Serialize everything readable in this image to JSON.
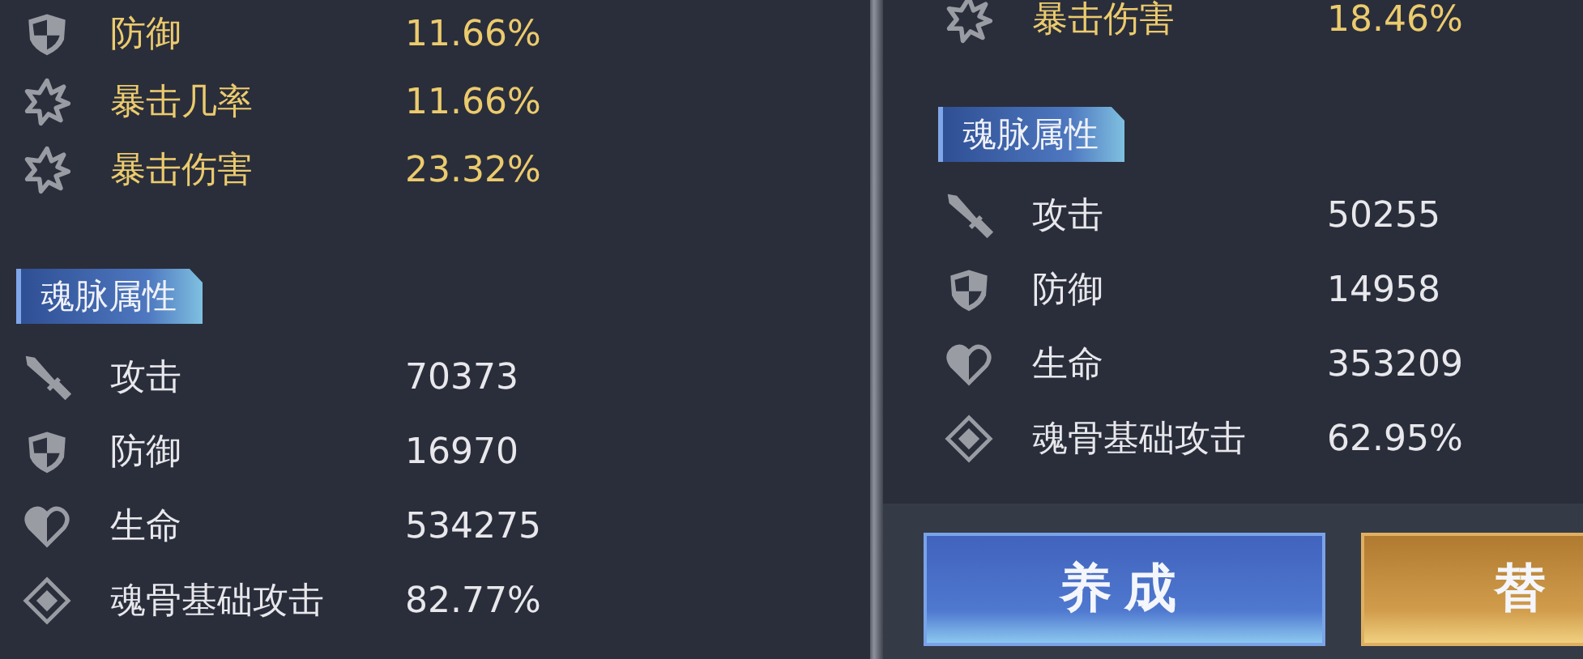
{
  "panels": [
    {
      "bonus_stats": [
        {
          "kind": "shield",
          "label": "防御",
          "value": "11.66%"
        },
        {
          "kind": "burst",
          "label": "暴击几率",
          "value": "11.66%"
        },
        {
          "kind": "burst",
          "label": "暴击伤害",
          "value": "23.32%"
        }
      ],
      "section_title": "魂脉属性",
      "stats": [
        {
          "kind": "sword",
          "label": "攻击",
          "value": "70373"
        },
        {
          "kind": "shield",
          "label": "防御",
          "value": "16970"
        },
        {
          "kind": "heart",
          "label": "生命",
          "value": "534275"
        },
        {
          "kind": "diamond",
          "label": "魂骨基础攻击",
          "value": "82.77%"
        }
      ]
    },
    {
      "bonus_stats": [
        {
          "kind": "burst",
          "label": "暴击伤害",
          "value": "18.46%"
        }
      ],
      "section_title": "魂脉属性",
      "stats": [
        {
          "kind": "sword",
          "label": "攻击",
          "value": "50255"
        },
        {
          "kind": "shield",
          "label": "防御",
          "value": "14958"
        },
        {
          "kind": "heart",
          "label": "生命",
          "value": "353209"
        },
        {
          "kind": "diamond",
          "label": "魂骨基础攻击",
          "value": "62.95%"
        }
      ],
      "buttons": [
        {
          "kind": "blue",
          "label": "养成"
        },
        {
          "kind": "gold",
          "label": "替"
        }
      ]
    }
  ]
}
